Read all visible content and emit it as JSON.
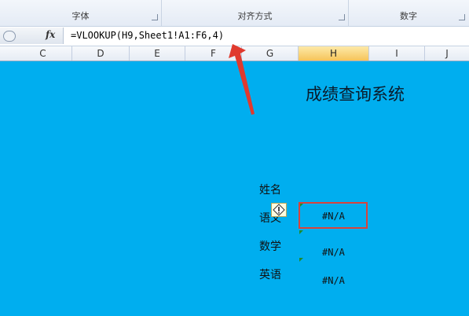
{
  "ribbon": {
    "groups": [
      {
        "label": "字体"
      },
      {
        "label": "对齐方式"
      },
      {
        "label": "数字"
      }
    ]
  },
  "formula_bar": {
    "fx": "fx",
    "formula": "=VLOOKUP(H9,Sheet1!A1:F6,4)"
  },
  "columns": [
    "C",
    "D",
    "E",
    "F",
    "G",
    "H",
    "I",
    "J"
  ],
  "selected_column": "H",
  "sheet": {
    "title": "成绩查询系统",
    "labels": [
      "姓名",
      "语文",
      "数学",
      "英语"
    ],
    "values": [
      "#N/A",
      "#N/A",
      "#N/A"
    ]
  },
  "colors": {
    "sheet_fill": "#00AEEF",
    "selection_border": "#d9433b",
    "arrow": "#e03a2e"
  },
  "error_icon": "warning-diamond-icon"
}
